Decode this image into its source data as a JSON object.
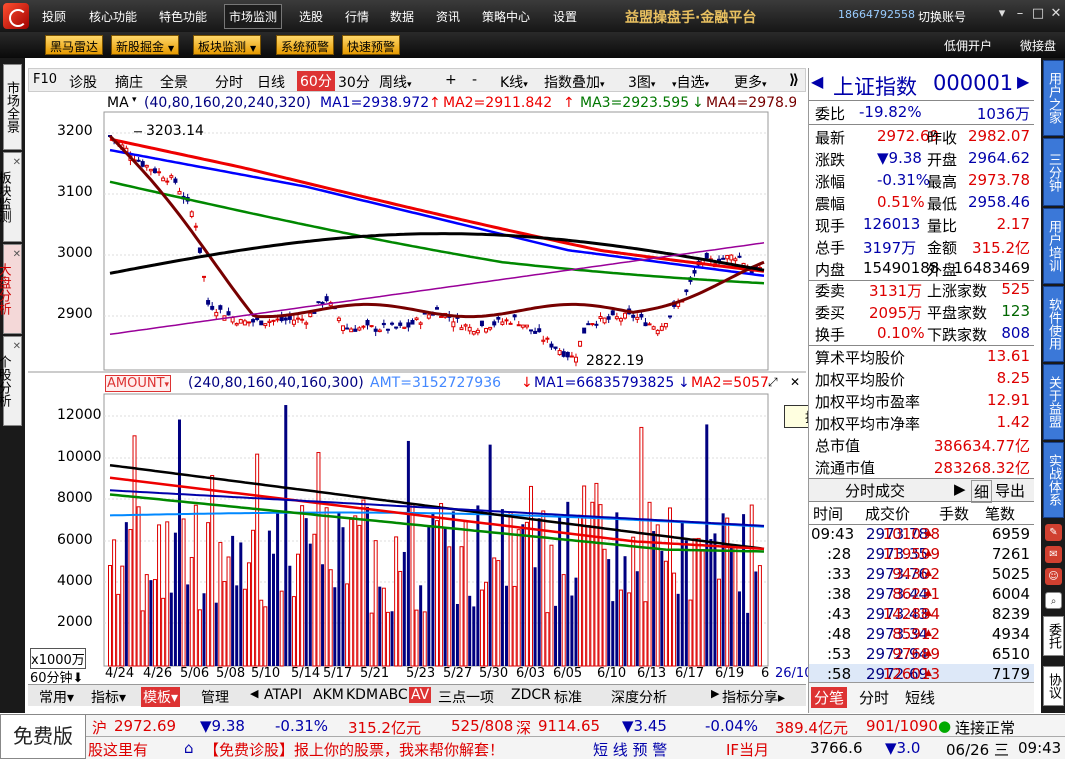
{
  "topmenu": {
    "items": [
      "投顾",
      "核心功能",
      "特色功能",
      "市场监测",
      "选股",
      "行情",
      "数据",
      "资讯",
      "策略中心",
      "设置"
    ],
    "active": "市场监测",
    "brand": "益盟操盘手·金融平台",
    "phone": "18664792558",
    "switch": "切换账号"
  },
  "toolbar2": {
    "buttons": [
      "黑马雷达",
      "新股掘金",
      "板块监测",
      "系统预警",
      "快速预警"
    ],
    "kaihu": "低佣开户",
    "weijie": "微接盘"
  },
  "lefttabs": [
    "市场全景",
    "板块监测",
    "大盘分析",
    "个股分析"
  ],
  "righttabs": [
    "用户之家",
    "三分钟",
    "用户培训",
    "软件使用",
    "关于益盟",
    "实战体系"
  ],
  "rightextra": [
    "委托",
    "协议"
  ],
  "charttoolbar": {
    "items": [
      "F10",
      "诊股",
      "摘庄",
      "全景",
      "分时",
      "日线",
      "60分",
      "30分",
      "周线",
      "+",
      "-",
      "K线",
      "指数叠加",
      "3图",
      "自选",
      "更多"
    ]
  },
  "main": {
    "ma_label": "MA",
    "ma_params": "(40,80,160,20,240,320)",
    "ma1": "MA1=2938.972",
    "ma2": "MA2=2911.842",
    "ma3": "MA3=2923.595",
    "ma4": "MA4=2978.9",
    "high_label": "3203.14",
    "low_label": "2822.19",
    "price_ticks": [
      "3200",
      "3100",
      "3000",
      "2900"
    ],
    "vol_label": "AMOUNT",
    "vol_params": "(240,80,160,40,160,300)",
    "amt": "AMT=3152727936",
    "vma1": "MA1=66835793825",
    "vma2": "MA2=5057",
    "vol_ticks": [
      "12000",
      "10000",
      "8000",
      "6000",
      "4000",
      "2000"
    ],
    "unit": "x1000万",
    "dates": [
      "4/24",
      "4/26",
      "5/06",
      "5/08",
      "5/10",
      "5/14",
      "5/17",
      "5/21",
      "5/23",
      "5/27",
      "5/30",
      "6/03",
      "6/05",
      "6/10",
      "6/13",
      "6/17",
      "6/19",
      "6",
      "26/10:0"
    ],
    "period": "60分钟",
    "tooltip": "指标框放大"
  },
  "bottomtabs": [
    "常用",
    "指标",
    "模板",
    "管理",
    "ATAPI",
    "AKM",
    "KDM",
    "ABC",
    "AV",
    "三点一项",
    "ZDCR",
    "标准",
    "深度分析",
    "指标分享"
  ],
  "quote": {
    "name": "上证指数",
    "code": "000001",
    "weibi_l": "委比",
    "weibi": "-19.82%",
    "weicha": "1036万",
    "rows": [
      [
        "最新",
        "2972.69",
        "昨收",
        "2982.07"
      ],
      [
        "涨跌",
        "▼9.38",
        "开盘",
        "2964.62"
      ],
      [
        "涨幅",
        "-0.31%",
        "最高",
        "2973.78"
      ],
      [
        "震幅",
        "0.51%",
        "最低",
        "2958.46"
      ],
      [
        "现手",
        "126013",
        "量比",
        "2.17"
      ],
      [
        "总手",
        "3197万",
        "金额",
        "315.2亿"
      ],
      [
        "内盘",
        "15490188",
        "外盘",
        "16483469"
      ]
    ],
    "rows2": [
      [
        "委卖",
        "3131万",
        "上涨家数",
        "525"
      ],
      [
        "委买",
        "2095万",
        "平盘家数",
        "123"
      ],
      [
        "换手",
        "0.10%",
        "下跌家数",
        "808"
      ]
    ],
    "rows3": [
      [
        "算术平均股价",
        "13.61"
      ],
      [
        "加权平均股价",
        "8.25"
      ],
      [
        "加权平均市盈率",
        "12.91"
      ],
      [
        "加权平均市净率",
        "1.42"
      ],
      [
        "总市值",
        "386634.77亿"
      ],
      [
        "流通市值",
        "283268.32亿"
      ]
    ],
    "ticktitle": "分时成交",
    "tickbtn1": "细",
    "tickbtn2": "导出",
    "tickhead": [
      "时间",
      "成交价",
      "手数",
      "笔数"
    ],
    "ticks": [
      [
        "09:43",
        "2973.78",
        "101038",
        "6959"
      ],
      [
        ":28",
        "2973.35",
        "119509",
        "7261"
      ],
      [
        ":33",
        "2973.76",
        "94302",
        "5025"
      ],
      [
        ":38",
        "2973.44",
        "86231",
        "6004"
      ],
      [
        ":43",
        "2973.43",
        "142884",
        "8239"
      ],
      [
        ":48",
        "2973.34",
        "85912",
        "4934"
      ],
      [
        ":53",
        "2972.94",
        "97689",
        "6510"
      ],
      [
        ":58",
        "2972.69",
        "126013",
        "7179"
      ]
    ],
    "bottom": [
      "分笔",
      "分时",
      "短线"
    ]
  },
  "status": {
    "free": "免费版",
    "sh": "沪",
    "sh_price": "2972.69",
    "sh_chg": "▼9.38",
    "sh_pct": "-0.31%",
    "sh_amt": "315.2亿元",
    "sh_ud": "525/808",
    "sz": "深",
    "sz_price": "9114.65",
    "sz_chg": "▼3.45",
    "sz_pct": "-0.04%",
    "sz_amt": "389.4亿元",
    "sz_ud": "901/1090",
    "conn": "连接正常",
    "ticker1": "股这里有",
    "ticker2": "【免费诊股】报上你的股票，我来帮你解套！",
    "alert": "短 线 预 警",
    "if": "IF当月",
    "if_price": "3766.6",
    "if_chg": "▼3.0",
    "date": "06/26 三",
    "time": "09:43"
  }
}
